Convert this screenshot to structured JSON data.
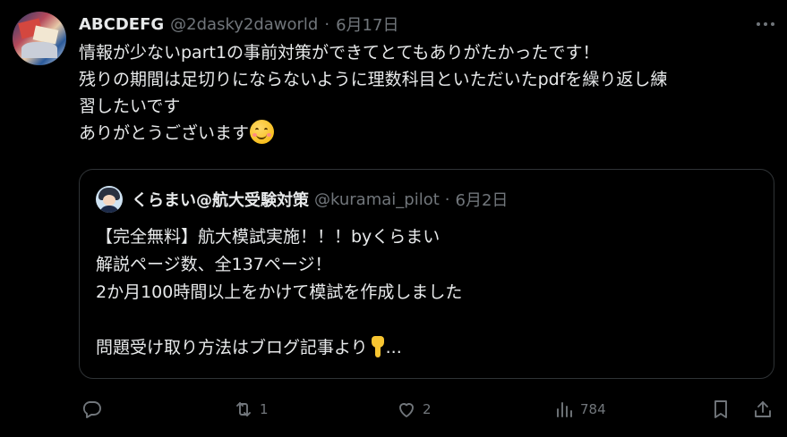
{
  "tweet": {
    "author_name": "ABCDEFG",
    "author_handle": "@2dasky2daworld",
    "separator": "·",
    "date": "6月17日",
    "lines": [
      "情報が少ないpart1の事前対策ができてとてもありがたかったです！",
      "残りの期間は足切りにならないように理数科目といただいたpdfを繰り返し練",
      "習したいです",
      "ありがとうございます"
    ],
    "emoji": "smiling-face-with-smiling-eyes"
  },
  "quote": {
    "author_name": "くらまい@航大受験対策",
    "author_handle": "@kuramai_pilot",
    "separator": "·",
    "date": "6月2日",
    "lines": [
      "【完全無料】航大模試実施！！！byくらまい",
      "解説ページ数、全137ページ！",
      "2か月100時間以上をかけて模試を作成しました",
      "",
      "問題受け取り方法はブログ記事より"
    ],
    "ellipsis": "...",
    "emoji": "backhand-index-pointing-down"
  },
  "actions": {
    "reply": {
      "icon": "reply-icon",
      "count": ""
    },
    "retweet": {
      "icon": "retweet-icon",
      "count": "1"
    },
    "like": {
      "icon": "heart-icon",
      "count": "2"
    },
    "views": {
      "icon": "views-icon",
      "count": "784"
    },
    "bookmark": {
      "icon": "bookmark-icon"
    },
    "share": {
      "icon": "share-icon"
    }
  },
  "colors": {
    "background": "#000000",
    "text": "#e7e9ea",
    "secondary": "#71767b",
    "border": "#2f3336"
  }
}
